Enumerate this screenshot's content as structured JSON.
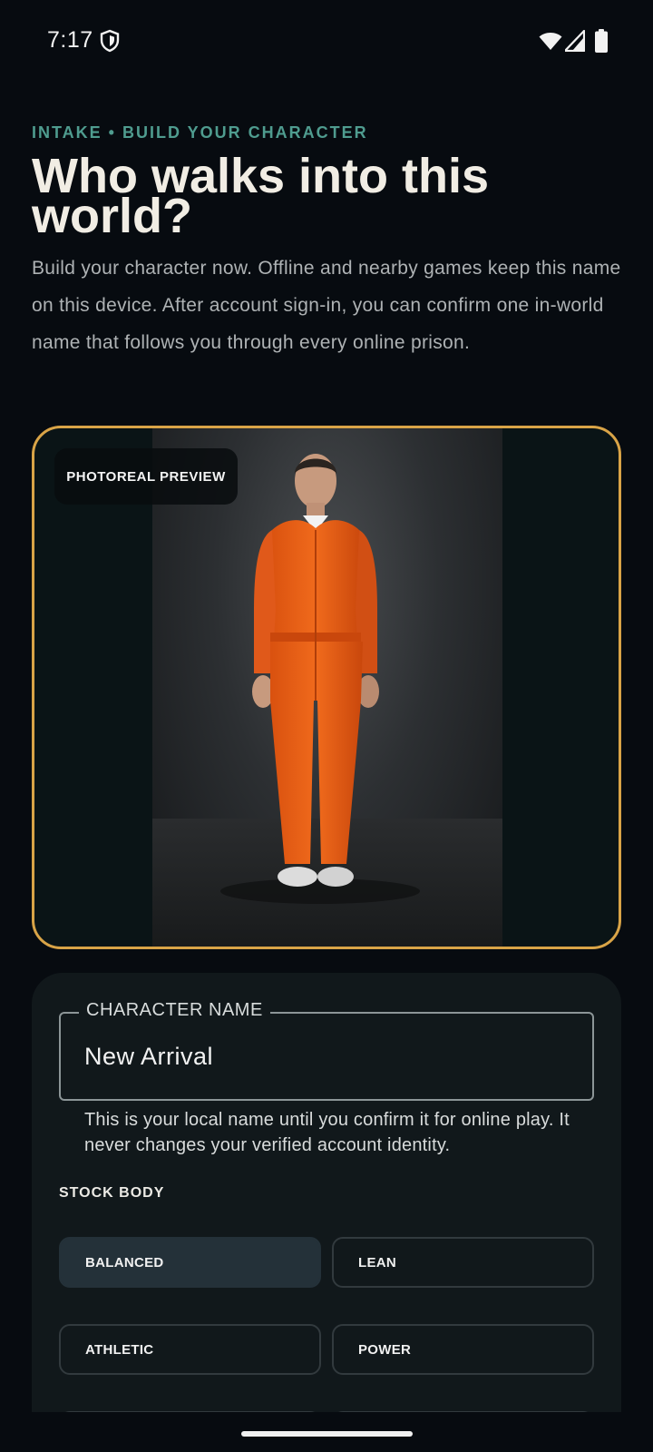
{
  "status_bar": {
    "time": "7:17",
    "icons": [
      "shield-icon",
      "wifi-icon",
      "signal-icon",
      "battery-icon"
    ]
  },
  "header": {
    "eyebrow": "INTAKE • BUILD YOUR CHARACTER",
    "title": "Who walks into this world?",
    "intro": "Build your character now. Offline and nearby games keep this name on this device. After account sign-in, you can confirm one in-world name that follows you through every online prison."
  },
  "preview": {
    "badge": "PHOTOREAL PREVIEW",
    "border_color": "#d9a447"
  },
  "form": {
    "name_label": "CHARACTER NAME",
    "name_value": "New Arrival",
    "helper": "This is your local name until you confirm it for online play. It never changes your verified account identity.",
    "body_section_label": "STOCK BODY",
    "body_options": [
      {
        "label": "BALANCED",
        "selected": true
      },
      {
        "label": "LEAN",
        "selected": false
      },
      {
        "label": "ATHLETIC",
        "selected": false
      },
      {
        "label": "POWER",
        "selected": false
      },
      {
        "label": "",
        "selected": false
      },
      {
        "label": "",
        "selected": false
      }
    ]
  },
  "colors": {
    "background": "#070b10",
    "accent_teal": "#4f9c8f",
    "accent_gold": "#d9a447",
    "panel": "#11181b",
    "selected_option": "#243139"
  }
}
